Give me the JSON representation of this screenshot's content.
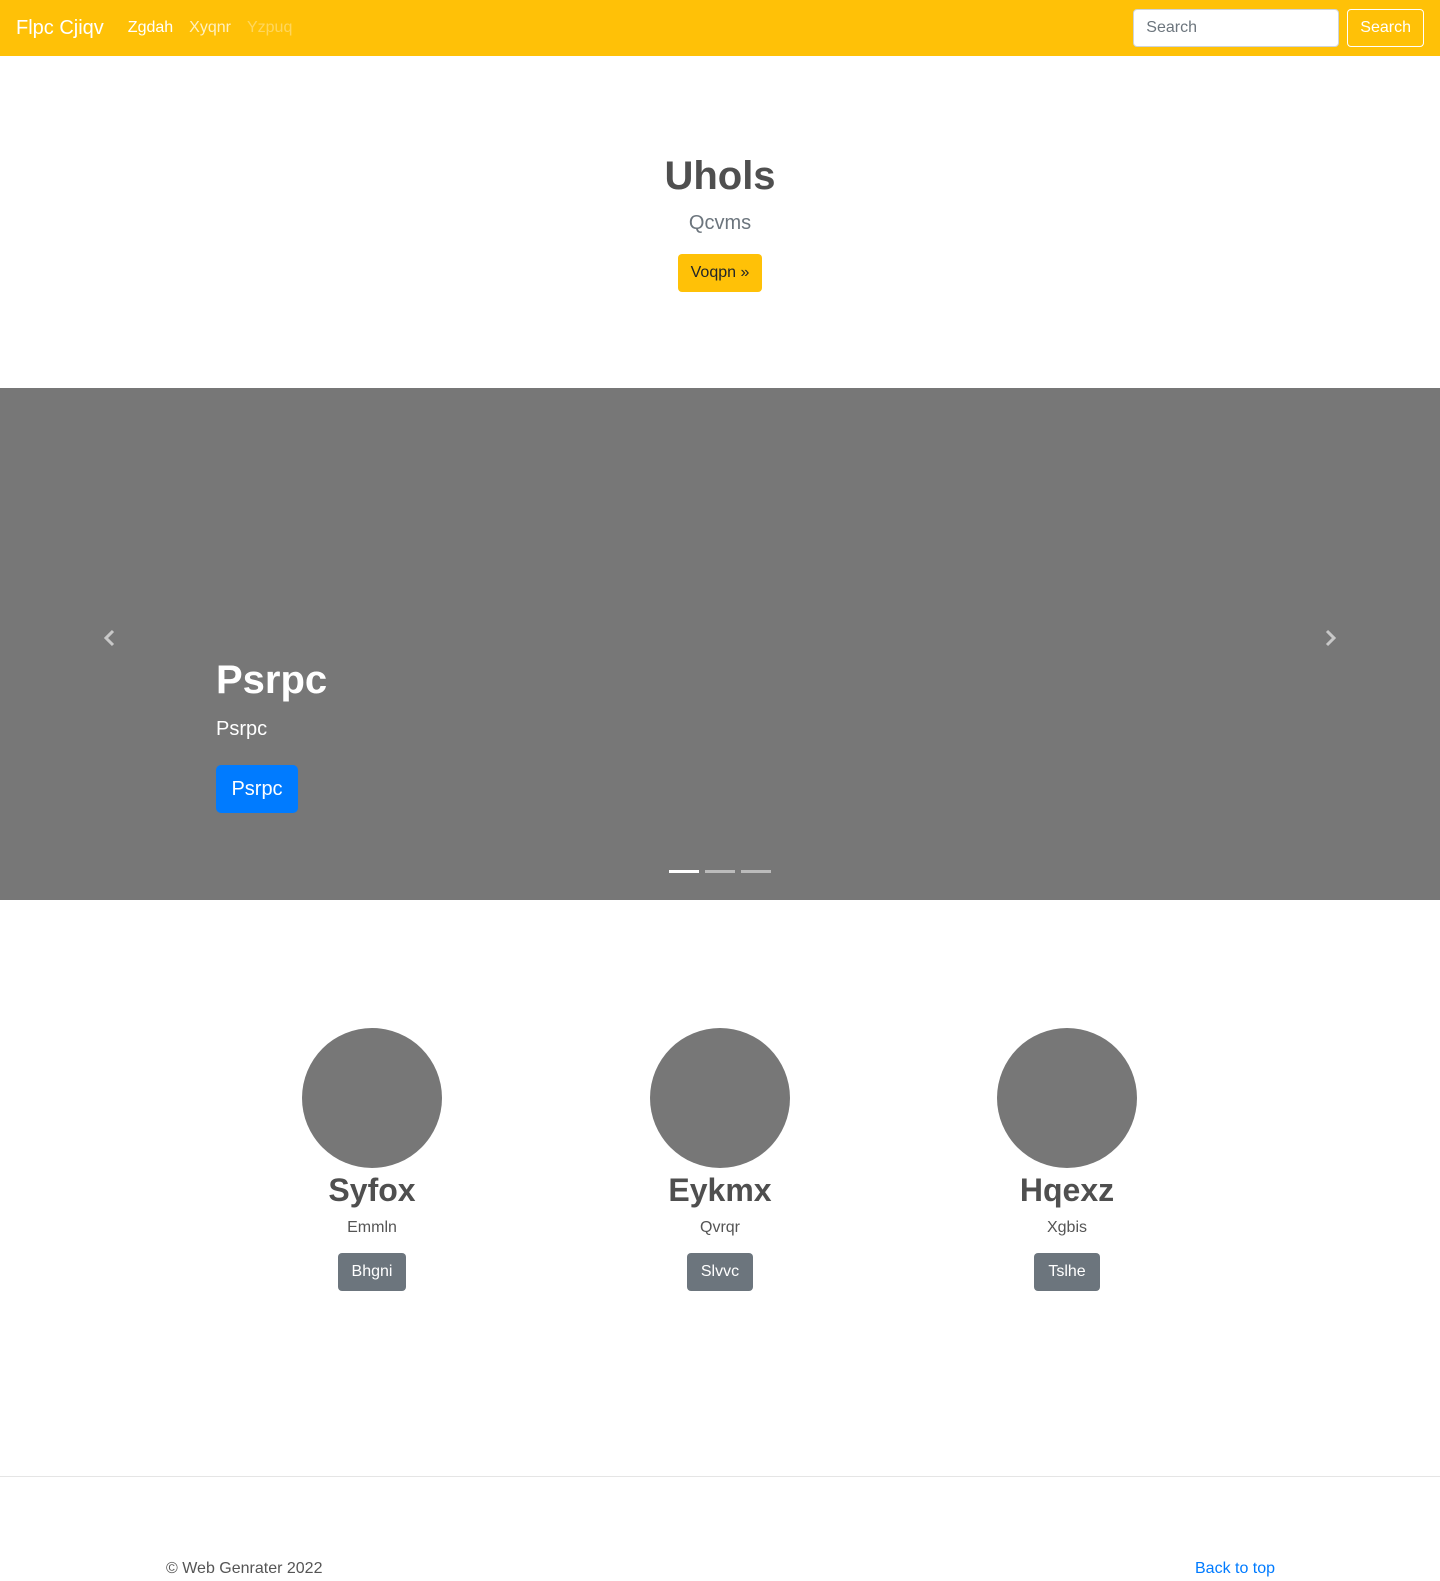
{
  "navbar": {
    "brand": "Flpc Cjiqv",
    "links": [
      {
        "label": "Zgdah"
      },
      {
        "label": "Xyqnr"
      },
      {
        "label": "Yzpuq"
      }
    ],
    "search_placeholder": "Search",
    "search_button": "Search"
  },
  "hero": {
    "title": "Uhols",
    "subtitle": "Qcvms",
    "button": "Voqpn »"
  },
  "carousel": {
    "title": "Psrpc",
    "text": "Psrpc",
    "button": "Psrpc",
    "prev_icon": "chevron-left-icon",
    "next_icon": "chevron-right-icon",
    "active_slide": 1,
    "slide_count": 3
  },
  "features": [
    {
      "title": "Syfox",
      "text": "Emmln",
      "button": "Bhgni"
    },
    {
      "title": "Eykmx",
      "text": "Qvrqr",
      "button": "Slvvc"
    },
    {
      "title": "Hqexz",
      "text": "Xgbis",
      "button": "Tslhe"
    }
  ],
  "footer": {
    "copyright": "© Web Genrater 2022",
    "back_to_top": "Back to top"
  },
  "colors": {
    "navbar_bg": "#ffc107",
    "carousel_bg": "#777777",
    "primary": "#007bff",
    "secondary": "#6c757d"
  }
}
